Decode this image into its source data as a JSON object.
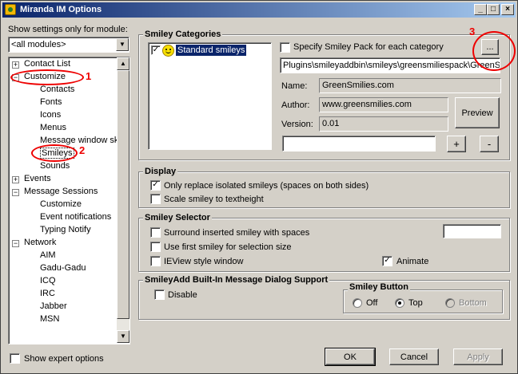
{
  "window": {
    "title": "Miranda IM Options",
    "min": "_",
    "max": "□",
    "close": "×"
  },
  "sidebar": {
    "filter_label": "Show settings only for module:",
    "filter_value": "<all modules>",
    "tree": [
      {
        "label": "Contact List",
        "level": 0,
        "expander": "+"
      },
      {
        "label": "Customize",
        "level": 0,
        "expander": "−"
      },
      {
        "label": "Contacts",
        "level": 1
      },
      {
        "label": "Fonts",
        "level": 1
      },
      {
        "label": "Icons",
        "level": 1
      },
      {
        "label": "Menus",
        "level": 1
      },
      {
        "label": "Message window ski",
        "level": 1
      },
      {
        "label": "Smileys",
        "level": 1,
        "selected": true
      },
      {
        "label": "Sounds",
        "level": 1
      },
      {
        "label": "Events",
        "level": 0,
        "expander": "+"
      },
      {
        "label": "Message Sessions",
        "level": 0,
        "expander": "−"
      },
      {
        "label": "Customize",
        "level": 1
      },
      {
        "label": "Event notifications",
        "level": 1
      },
      {
        "label": "Typing Notify",
        "level": 1
      },
      {
        "label": "Network",
        "level": 0,
        "expander": "−"
      },
      {
        "label": "AIM",
        "level": 1
      },
      {
        "label": "Gadu-Gadu",
        "level": 1
      },
      {
        "label": "ICQ",
        "level": 1
      },
      {
        "label": "IRC",
        "level": 1
      },
      {
        "label": "Jabber",
        "level": 1
      },
      {
        "label": "MSN",
        "level": 1
      }
    ],
    "expert_label": "Show expert options"
  },
  "smiley_categories": {
    "title": "Smiley Categories",
    "list_item": "Standard smileys",
    "specify_label": "Specify Smiley Pack for each category",
    "browse_label": "...",
    "path": "Plugins\\smileyaddbin\\smileys\\greensmiliespack\\GreenSm",
    "name_label": "Name:",
    "name_value": "GreenSmilies.com",
    "author_label": "Author:",
    "author_value": "www.greensmilies.com",
    "version_label": "Version:",
    "version_value": "0.01",
    "preview_label": "Preview",
    "add_label": "+",
    "remove_label": "-",
    "new_category_value": ""
  },
  "display": {
    "title": "Display",
    "only_replace_label": "Only replace isolated smileys (spaces on both sides)",
    "scale_label": "Scale smiley to textheight"
  },
  "selector": {
    "title": "Smiley Selector",
    "surround_label": "Surround inserted smiley with spaces",
    "first_smiley_label": "Use first smiley for selection size",
    "ieview_label": "IEView style window",
    "animate_label": "Animate",
    "color_value": ""
  },
  "builtin": {
    "title": "SmileyAdd Built-In Message Dialog Support",
    "disable_label": "Disable",
    "button_group_title": "Smiley Button",
    "off_label": "Off",
    "top_label": "Top",
    "bottom_label": "Bottom"
  },
  "footer": {
    "ok": "OK",
    "cancel": "Cancel",
    "apply": "Apply"
  },
  "annotations": {
    "one": "1",
    "two": "2",
    "three": "3"
  },
  "colors": {
    "annotation": "#e00000",
    "selection": "#0a246a",
    "face": "#d4d0c8"
  }
}
